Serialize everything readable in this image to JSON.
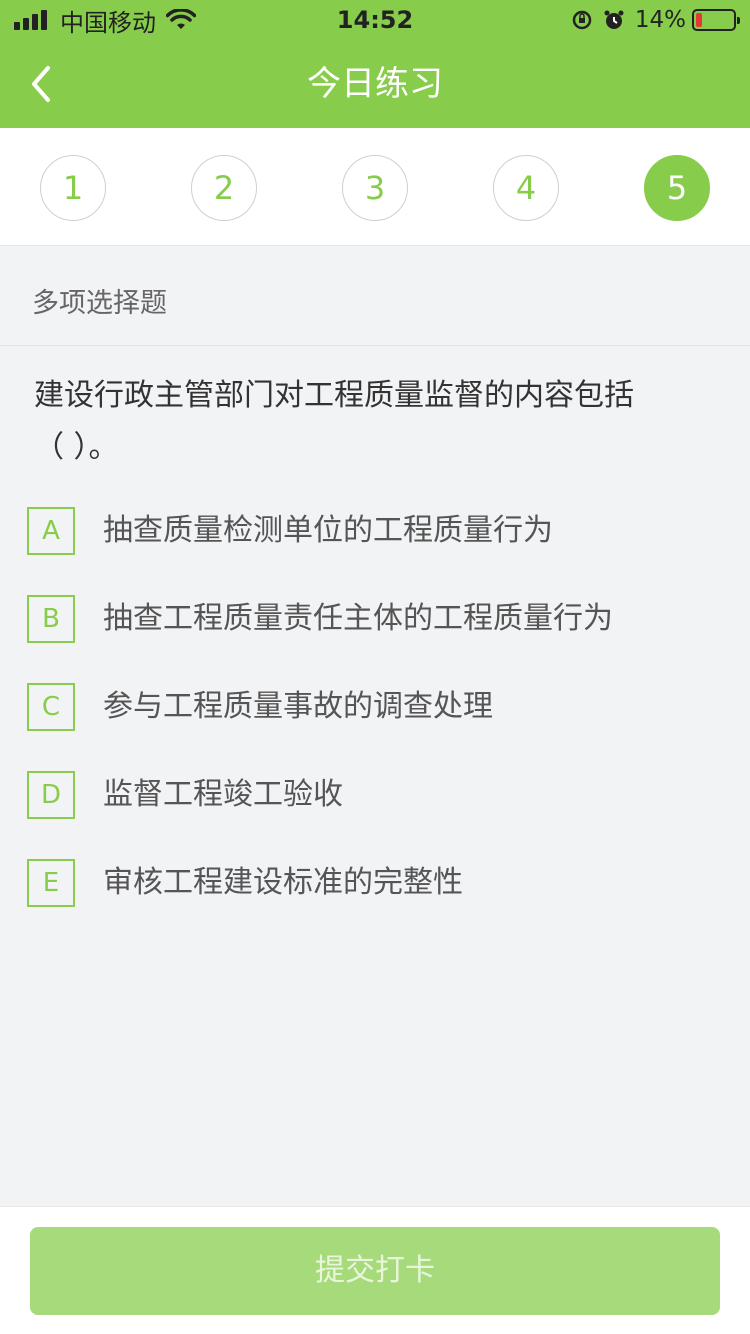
{
  "status_bar": {
    "carrier": "中国移动",
    "time": "14:52",
    "battery_percent": "14%",
    "battery_level": 0.14
  },
  "nav": {
    "title": "今日练习",
    "back_icon": "chevron-left-icon"
  },
  "question_numbers": [
    {
      "label": "1",
      "active": false
    },
    {
      "label": "2",
      "active": false
    },
    {
      "label": "3",
      "active": false
    },
    {
      "label": "4",
      "active": false
    },
    {
      "label": "5",
      "active": true
    }
  ],
  "question": {
    "type": "多项选择题",
    "text_line1": "建设行政主管部门对工程质量监督的内容包括",
    "text_line2": "（   ）。",
    "options": [
      {
        "letter": "A",
        "text": "抽查质量检测单位的工程质量行为"
      },
      {
        "letter": "B",
        "text": "抽查工程质量责任主体的工程质量行为"
      },
      {
        "letter": "C",
        "text": "参与工程质量事故的调查处理"
      },
      {
        "letter": "D",
        "text": "监督工程竣工验收"
      },
      {
        "letter": "E",
        "text": "审核工程建设标准的完整性"
      }
    ]
  },
  "submit_label": "提交打卡",
  "colors": {
    "accent": "#88cc4b",
    "submit_disabled": "#a7da7a",
    "background": "#f2f3f5"
  }
}
